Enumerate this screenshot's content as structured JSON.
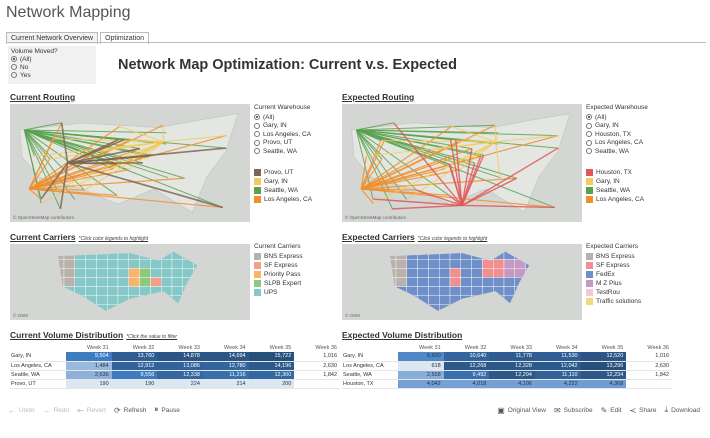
{
  "app_title": "Network Mapping",
  "tabs": [
    {
      "label": "Current Network Overview"
    },
    {
      "label": "Optimization"
    }
  ],
  "filter": {
    "title": "Volume Moved?",
    "options": [
      "(All)",
      "No",
      "Yes"
    ],
    "selected": 0
  },
  "dashboard_title": "Network Map Optimization: Current v.s. Expected",
  "current_routing": {
    "title": "Current Routing",
    "legend_title": "Current Warehouse",
    "options": [
      "(All)",
      "Gary, IN",
      "Los Angeles, CA",
      "Provo, UT",
      "Seattle, WA"
    ],
    "colors": [
      {
        "label": "Provo, UT",
        "color": "#7b6754"
      },
      {
        "label": "Gary, IN",
        "color": "#f3cb5a"
      },
      {
        "label": "Seattle, WA",
        "color": "#59a14f"
      },
      {
        "label": "Los Angeles, CA",
        "color": "#f28e2b"
      }
    ],
    "attribution": "© OpenStreetMap contributors"
  },
  "expected_routing": {
    "title": "Expected Routing",
    "legend_title": "Expected Warehouse",
    "options": [
      "(All)",
      "Gary, IN",
      "Houston, TX",
      "Los Angeles, CA",
      "Seattle, WA"
    ],
    "colors": [
      {
        "label": "Houston, TX",
        "color": "#e15759"
      },
      {
        "label": "Gary, IN",
        "color": "#f3cb5a"
      },
      {
        "label": "Seattle, WA",
        "color": "#59a14f"
      },
      {
        "label": "Los Angeles, CA",
        "color": "#f28e2b"
      }
    ],
    "attribution": "© OpenStreetMap contributors"
  },
  "current_carriers": {
    "title": "Current Carriers",
    "note": "*Click color legends to highlight",
    "legend_title": "Current Carriers",
    "items": [
      {
        "label": "BNS Express",
        "color": "#bab0ac"
      },
      {
        "label": "SF Express",
        "color": "#f2a08a"
      },
      {
        "label": "Priority Pass",
        "color": "#f6b56b"
      },
      {
        "label": "SLPB Expert",
        "color": "#8cc97b"
      },
      {
        "label": "UPS",
        "color": "#86c7c8"
      }
    ],
    "attribution": "© OSM"
  },
  "expected_carriers": {
    "title": "Expected Carriers",
    "note": "*Click color legends to highlight",
    "legend_title": "Expected Carriers",
    "items": [
      {
        "label": "BNS Express",
        "color": "#bab0ac"
      },
      {
        "label": "SF Express",
        "color": "#f08f8f"
      },
      {
        "label": "FedEx",
        "color": "#6f8fc9"
      },
      {
        "label": "M Z Plus",
        "color": "#c49ac4"
      },
      {
        "label": "TestRou",
        "color": "#f4c9d6"
      },
      {
        "label": "Traffic solutions",
        "color": "#f4d97a"
      }
    ],
    "attribution": "© OSM"
  },
  "current_volume": {
    "title": "Current Volume Distribution",
    "note": "*Click the value to filter",
    "weeks": [
      "Week 31",
      "Week 32",
      "Week 33",
      "Week 34",
      "Week 35",
      "Week 36"
    ],
    "rows": [
      {
        "label": "Gary, IN",
        "values": [
          "9,504",
          "13,760",
          "14,878",
          "14,694",
          "15,722",
          "1,016"
        ]
      },
      {
        "label": "Los Angeles, CA",
        "values": [
          "1,484",
          "12,912",
          "13,086",
          "12,780",
          "14,196",
          "2,630"
        ]
      },
      {
        "label": "Seattle, WA",
        "values": [
          "2,636",
          "9,556",
          "12,338",
          "11,216",
          "12,300",
          "1,842"
        ]
      },
      {
        "label": "Provo, UT",
        "values": [
          "190",
          "190",
          "224",
          "214",
          "200",
          ""
        ]
      }
    ]
  },
  "expected_volume": {
    "title": "Expected Volume Distribution",
    "weeks": [
      "Week 31",
      "Week 32",
      "Week 33",
      "Week 34",
      "Week 35",
      "Week 36"
    ],
    "rows": [
      {
        "label": "Gary, IN",
        "values": [
          "6,600",
          "10,640",
          "11,778",
          "11,530",
          "12,520",
          "1,016"
        ]
      },
      {
        "label": "Los Angeles, CA",
        "values": [
          "618",
          "12,268",
          "12,328",
          "12,042",
          "13,296",
          "2,630"
        ]
      },
      {
        "label": "Seattle, WA",
        "values": [
          "2,558",
          "9,492",
          "12,294",
          "11,110",
          "12,234",
          "1,842"
        ]
      },
      {
        "label": "Houston, TX",
        "values": [
          "4,042",
          "4,018",
          "4,106",
          "4,222",
          "4,368",
          ""
        ]
      }
    ]
  },
  "toolbar": {
    "undo": "Undo",
    "redo": "Redo",
    "revert": "Revert",
    "refresh": "Refresh",
    "pause": "Pause",
    "original_view": "Original View",
    "subscribe": "Subscribe",
    "edit": "Edit",
    "share": "Share",
    "download": "Download"
  }
}
